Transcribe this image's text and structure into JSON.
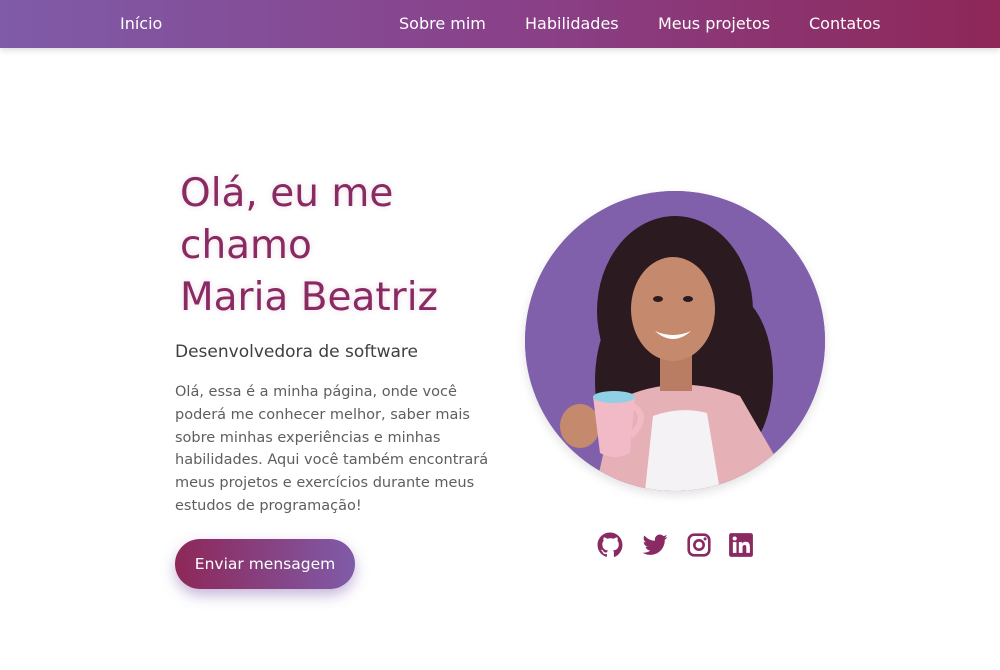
{
  "navbar": {
    "home_label": "Início",
    "items": [
      {
        "label": "Sobre mim"
      },
      {
        "label": "Habilidades"
      },
      {
        "label": "Meus projetos"
      },
      {
        "label": "Contatos"
      }
    ]
  },
  "hero": {
    "title_line1": "Olá, eu me",
    "title_line2": "chamo",
    "title_line3": "Maria Beatriz",
    "subtitle": "Desenvolvedora de software",
    "description": "Olá, essa é a minha página, onde você poderá me conhecer melhor, saber mais sobre minhas experiências e minhas habilidades. Aqui você também encontrará meus projetos e exercícios durante meus estudos de programação!",
    "button_label": "Enviar mensagem"
  },
  "social": {
    "icons": [
      "github-icon",
      "twitter-icon",
      "instagram-icon",
      "linkedin-icon"
    ]
  },
  "colors": {
    "accent_purple": "#7f5ba8",
    "accent_wine": "#8e2758",
    "title_color": "#8a2a62"
  }
}
